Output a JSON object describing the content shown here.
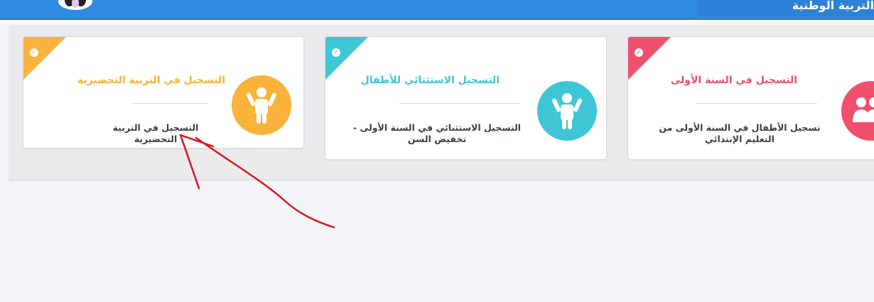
{
  "header": {
    "title": "التربية الوطنية",
    "logo_icon": "penguin-logo-icon",
    "bg_color": "#2f8be0"
  },
  "cards": [
    {
      "title": "التسجيل في السنة الأولى",
      "description": "تسجيل الأطفال في السنة الأولى من التعليم الإبتدائي",
      "color": "#f0506e",
      "icon": "family-icon",
      "badge_icon": "check-icon"
    },
    {
      "title": "التسجيل الاستثنائي للأطفال",
      "description": "التسجيل الاستثنائي في السنة الأولى - تخفيض السن",
      "color": "#3ec6d6",
      "icon": "child-icon",
      "badge_icon": "check-icon"
    },
    {
      "title": "التسجيل في التربية التحضيرية",
      "description": "التسجيل في التربية التحضيرية",
      "color": "#f9b23a",
      "icon": "child-icon",
      "badge_icon": "check-icon"
    }
  ],
  "annotation": {
    "icon": "hand-drawn-arrow-icon",
    "color": "#d9161c"
  }
}
